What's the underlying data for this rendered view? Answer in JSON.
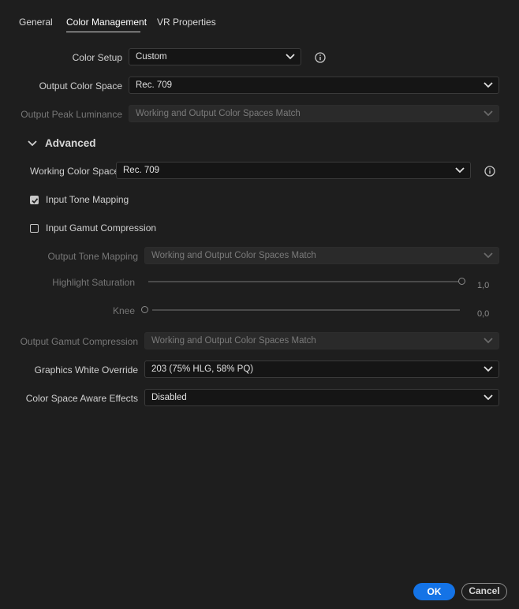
{
  "tabs": [
    {
      "label": "General"
    },
    {
      "label": "Color Management"
    },
    {
      "label": "VR Properties"
    }
  ],
  "color_setup": {
    "label": "Color Setup",
    "value": "Custom"
  },
  "output_color_space": {
    "label": "Output Color Space",
    "value": "Rec. 709"
  },
  "output_peak_luminance": {
    "label": "Output Peak Luminance",
    "value": "Working and Output Color Spaces Match"
  },
  "advanced": {
    "title": "Advanced"
  },
  "working_color_space": {
    "label": "Working Color Space",
    "value": "Rec. 709"
  },
  "input_tone_mapping": {
    "label": "Input Tone Mapping",
    "checked": true
  },
  "input_gamut_compression": {
    "label": "Input Gamut Compression",
    "checked": false
  },
  "output_tone_mapping": {
    "label": "Output Tone Mapping",
    "value": "Working and Output Color Spaces Match"
  },
  "highlight_saturation": {
    "label": "Highlight Saturation",
    "value": "1,0"
  },
  "knee": {
    "label": "Knee",
    "value": "0,0"
  },
  "output_gamut_compression": {
    "label": "Output Gamut Compression",
    "value": "Working and Output Color Spaces Match"
  },
  "graphics_white_override": {
    "label": "Graphics White Override",
    "value": "203 (75% HLG, 58% PQ)"
  },
  "color_space_aware_effects": {
    "label": "Color Space Aware Effects",
    "value": "Disabled"
  },
  "buttons": {
    "ok": "OK",
    "cancel": "Cancel"
  },
  "colors": {
    "accent": "#1473e6",
    "background": "#1e1e1e"
  }
}
